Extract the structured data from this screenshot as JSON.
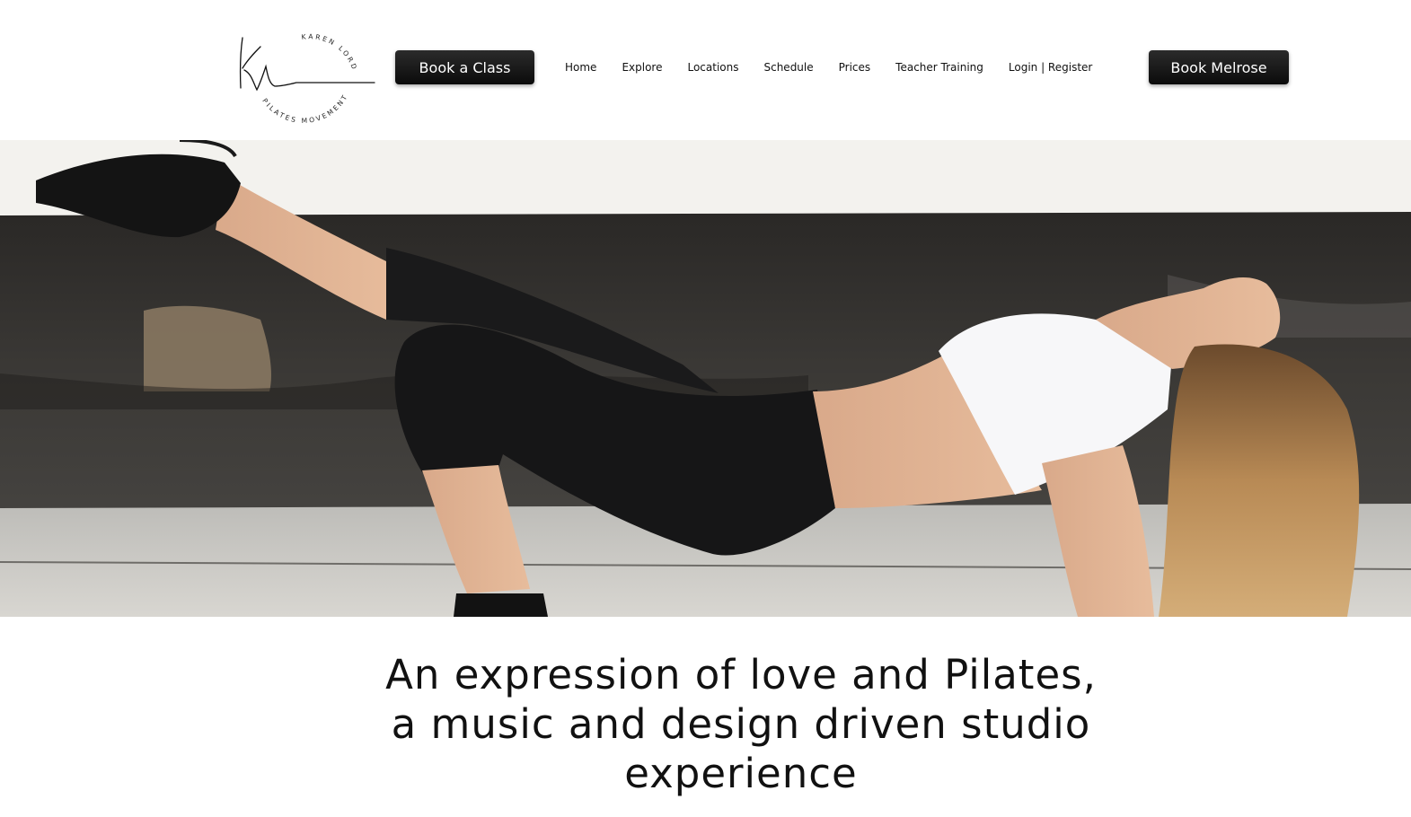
{
  "header": {
    "logo": {
      "ring_top": "KAREN LORD",
      "ring_bottom": "PILATES MOVEMENT",
      "signature": "KL"
    },
    "book_class_label": "Book a Class",
    "book_melrose_label": "Book Melrose",
    "nav": [
      {
        "label": "Home"
      },
      {
        "label": "Explore"
      },
      {
        "label": "Locations"
      },
      {
        "label": "Schedule"
      },
      {
        "label": "Prices"
      },
      {
        "label": "Teacher Training"
      },
      {
        "label": "Login | Register"
      }
    ]
  },
  "hero": {
    "image": "woman-pilates-tabletop-pose-on-rooftop"
  },
  "headline": {
    "line1": "An expression of love and Pilates,",
    "line2": "a music and design driven studio",
    "line3": "experience"
  },
  "colors": {
    "button_bg": "#111111",
    "button_text": "#ffffff",
    "text": "#111111",
    "background": "#ffffff"
  }
}
